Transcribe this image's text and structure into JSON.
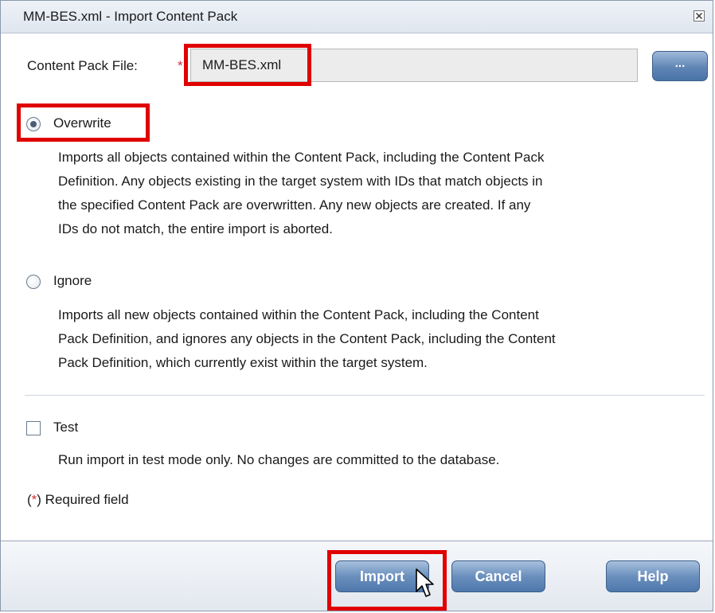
{
  "window": {
    "title": "MM-BES.xml - Import Content Pack"
  },
  "file": {
    "label": "Content Pack File:",
    "required_marker": "*",
    "value": "MM-BES.xml",
    "browse_label": "..."
  },
  "options": {
    "overwrite": {
      "label": "Overwrite",
      "selected": true,
      "description_lines": [
        "Imports all objects contained within the Content Pack, including the Content Pack",
        "Definition. Any objects existing in the target system with IDs that match objects in",
        "the specified Content Pack are overwritten. Any new objects are created. If any",
        "IDs do not match, the entire import is aborted."
      ]
    },
    "ignore": {
      "label": "Ignore",
      "selected": false,
      "description_lines": [
        "Imports all new objects contained within the Content Pack, including the Content",
        "Pack Definition, and ignores any objects in the Content Pack, including the Content",
        "Pack Definition, which currently exist within the target system."
      ]
    }
  },
  "test": {
    "label": "Test",
    "checked": false,
    "description": "Run import in test mode only. No changes are committed to the database."
  },
  "required_note": {
    "open": "(",
    "star": "*",
    "text": ") Required field"
  },
  "buttons": {
    "import": "Import",
    "cancel": "Cancel",
    "help": "Help"
  },
  "colors": {
    "highlight": "#e00000",
    "required": "#d0313a",
    "button_blue": "#5f86b5"
  }
}
